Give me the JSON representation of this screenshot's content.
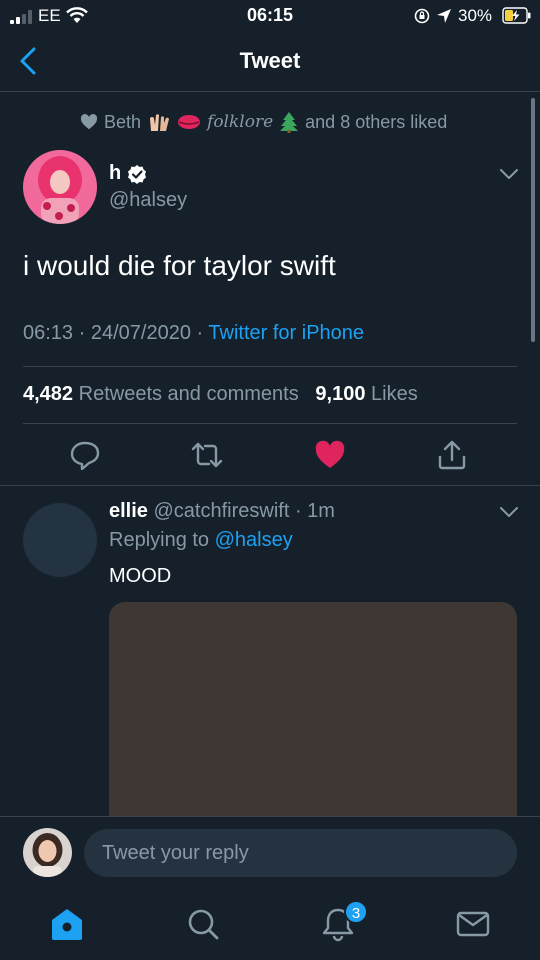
{
  "status_bar": {
    "carrier": "EE",
    "time": "06:15",
    "battery_percent": "30%"
  },
  "header": {
    "title": "Tweet"
  },
  "tweet": {
    "social_context": {
      "liker": "Beth",
      "tag": "folklore",
      "suffix": "and 8 others liked"
    },
    "author_name": "h",
    "author_handle": "@halsey",
    "text": "i would die for taylor swift",
    "time": "06:13",
    "date": "24/07/2020",
    "source": "Twitter for iPhone",
    "retweets_count": "4,482",
    "retweets_label": "Retweets and comments",
    "likes_count": "9,100",
    "likes_label": "Likes"
  },
  "reply": {
    "author_name": "ellie",
    "author_handle": "@catchfireswift",
    "age": "1m",
    "replying_label": "Replying to",
    "replying_to": "@halsey",
    "text": "MOOD"
  },
  "composer": {
    "placeholder": "Tweet your reply"
  },
  "tabbar": {
    "notifications_badge": "3"
  },
  "colors": {
    "background": "#15202b",
    "accent": "#1da1f2",
    "like": "#e0245e",
    "muted": "#8899a6"
  }
}
